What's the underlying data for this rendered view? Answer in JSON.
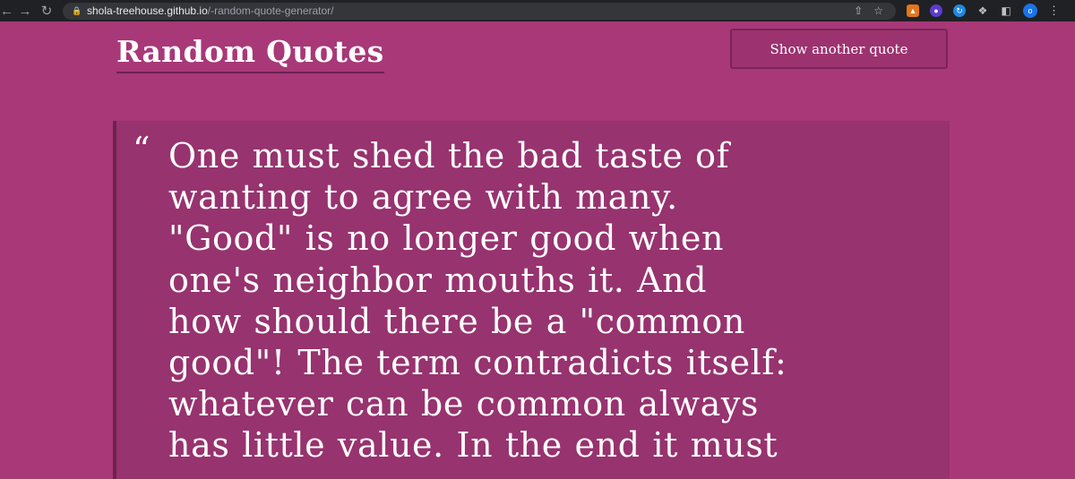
{
  "browser": {
    "url_host": "shola-treehouse.github.io",
    "url_path": "/-random-quote-generator/",
    "profile_initial": "o"
  },
  "header": {
    "title": "Random Quotes",
    "button_label": "Show another quote"
  },
  "quote": {
    "mark": "“",
    "lines": [
      "One must shed the bad taste of",
      "wanting to agree with many.",
      "\"Good\" is no longer good when",
      "one's neighbor mouths it. And",
      "how should there be a \"common",
      "good\"! The term contradicts itself:",
      "whatever can be common always",
      "has little value. In the end it must"
    ]
  },
  "colors": {
    "page_background": "#a83878",
    "quote_background": "#97336f",
    "accent_border": "#6e2150"
  }
}
